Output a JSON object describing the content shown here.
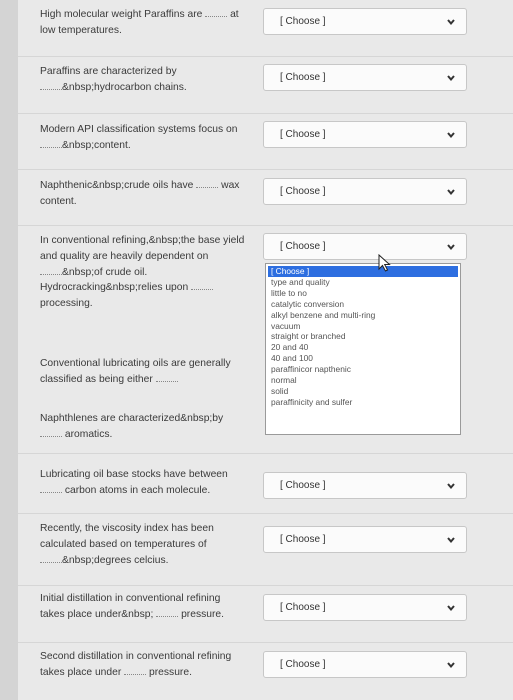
{
  "questions": [
    {
      "line1": "High molecular weight Paraffins are ",
      "line1b": " at",
      "line2": "low temperatures.",
      "select": "[ Choose ]"
    },
    {
      "line1": "Paraffins are characterized by",
      "line2": "&nbsp;hydrocarbon chains.",
      "select": "[ Choose ]"
    },
    {
      "line1": "Modern API classification systems focus on",
      "line2": "&nbsp;content.",
      "select": "[ Choose ]"
    },
    {
      "line1": "Naphthenic&nbsp;crude oils have ",
      "line1b": " wax",
      "line2": "content.",
      "select": "[ Choose ]"
    },
    {
      "line1": "In conventional refining,&nbsp;the base yield",
      "line2": "and quality are heavily dependent on",
      "line3": "&nbsp;of crude oil.",
      "select": "[ Choose ]"
    },
    {
      "line1": "Hydrocracking&nbsp;relies upon ",
      "line2": "processing.",
      "select": ""
    },
    {
      "line1": "Conventional lubricating oils are generally",
      "line2": "classified as being either ",
      "select": ""
    },
    {
      "line1": "Naphthlenes are characterized&nbsp;by",
      "line2": " aromatics.",
      "select": ""
    },
    {
      "line1": "Lubricating oil base stocks have between",
      "line2": " carbon atoms in each molecule.",
      "select": "[ Choose ]"
    },
    {
      "line1": "Recently, the viscosity index has been",
      "line2": "calculated based on temperatures of",
      "line3": "&nbsp;degrees celcius.",
      "select": "[ Choose ]"
    },
    {
      "line1": "Initial distillation in conventional refining",
      "line2": "takes place under&nbsp; ",
      "line2b": " pressure.",
      "select": "[ Choose ]"
    },
    {
      "line1": "Second distillation in conventional refining",
      "line2": "takes place under ",
      "line2b": " pressure.",
      "select": "[ Choose ]"
    }
  ],
  "dropdown_options": [
    "[ Choose ]",
    "type and quality",
    "little to no",
    "catalytic conversion",
    "alkyl benzene and multi-ring",
    "vacuum",
    "straight or branched",
    "20 and 40",
    "40 and 100",
    "paraffinicor napthenic",
    "normal",
    "solid",
    "paraffinicity and sulfer"
  ],
  "icons": {
    "chevron": "chevron-down-icon",
    "cursor": "mouse-pointer-icon"
  }
}
